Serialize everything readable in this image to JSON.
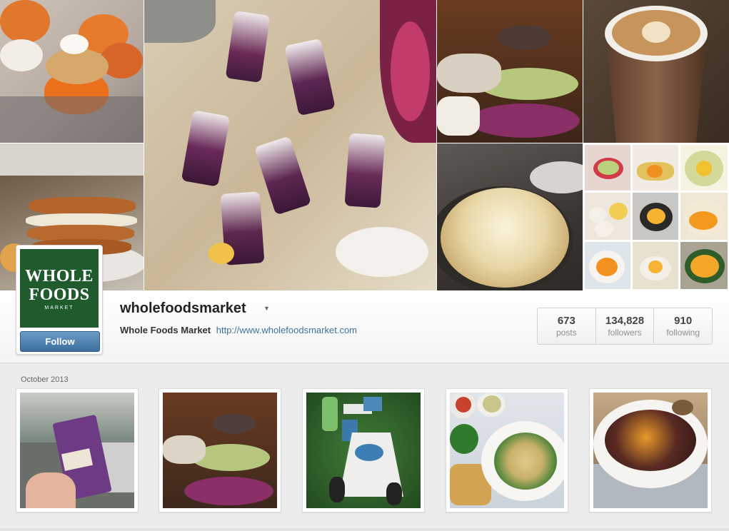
{
  "profile": {
    "username": "wholefoodsmarket",
    "full_name": "Whole Foods Market",
    "website": "http://www.wholefoodsmarket.com",
    "follow_label": "Follow",
    "logo_text": [
      "WHOLE",
      "FOODS",
      "MARKET"
    ]
  },
  "stats": [
    {
      "value": "673",
      "label": "posts"
    },
    {
      "value": "134,828",
      "label": "followers"
    },
    {
      "value": "910",
      "label": "following"
    }
  ],
  "feed": {
    "month_label": "October 2013"
  },
  "icons": {
    "dropdown": "caret-down-icon"
  },
  "colors": {
    "logo_green": "#1f5b2d",
    "follow_button": "#3c6f9e",
    "link": "#3f729b"
  }
}
